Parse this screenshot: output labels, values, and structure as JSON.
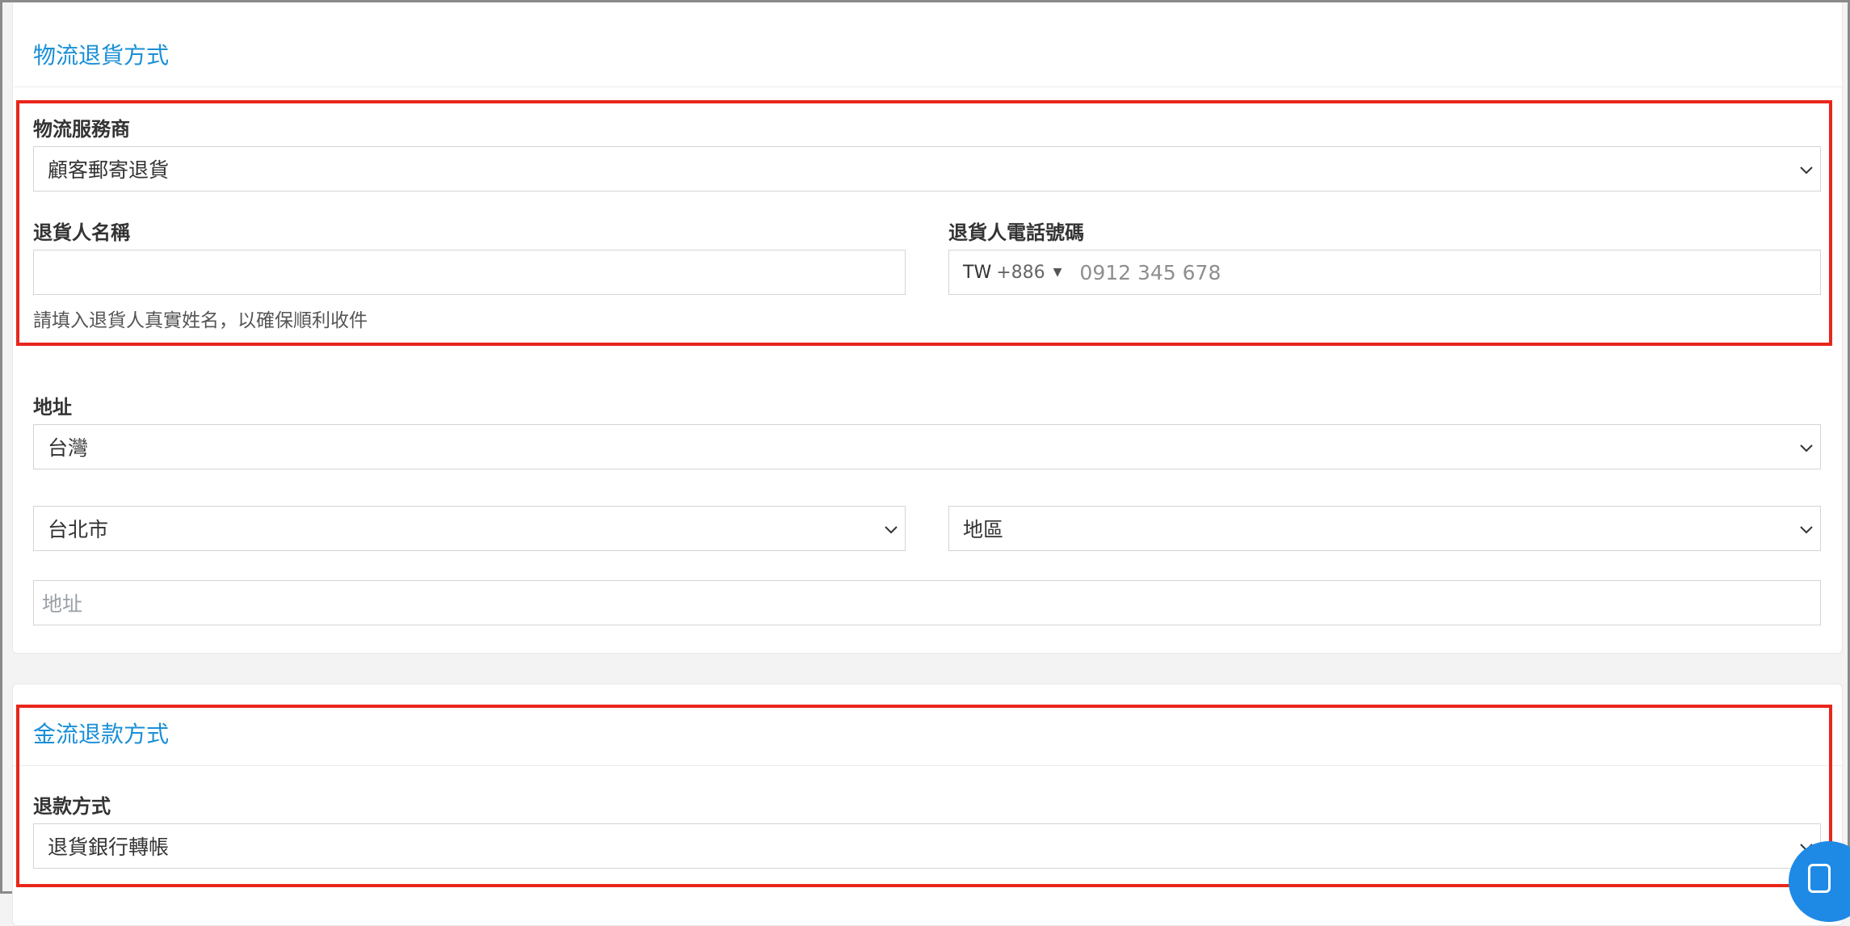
{
  "logistics": {
    "section_title": "物流退貨方式",
    "provider_label": "物流服務商",
    "provider_value": "顧客郵寄退貨",
    "name_label": "退貨人名稱",
    "name_value": "",
    "name_help": "請填入退貨人真實姓名，以確保順利收件",
    "phone_label": "退貨人電話號碼",
    "phone_country": "TW",
    "phone_code": "+886",
    "phone_placeholder": "0912 345 678",
    "address_label": "地址",
    "country_value": "台灣",
    "city_value": "台北市",
    "district_value": "地區",
    "address_placeholder": "地址"
  },
  "payment": {
    "section_title": "金流退款方式",
    "refund_label": "退款方式",
    "refund_value": "退貨銀行轉帳"
  },
  "icons": {
    "dropdown": "chevron-down-icon",
    "phone_caret": "caret-down-icon",
    "chat": "chat-bubble-icon"
  },
  "colors": {
    "accent": "#1a8fd6",
    "highlight": "#e8261b",
    "chat": "#1e8ae6"
  }
}
